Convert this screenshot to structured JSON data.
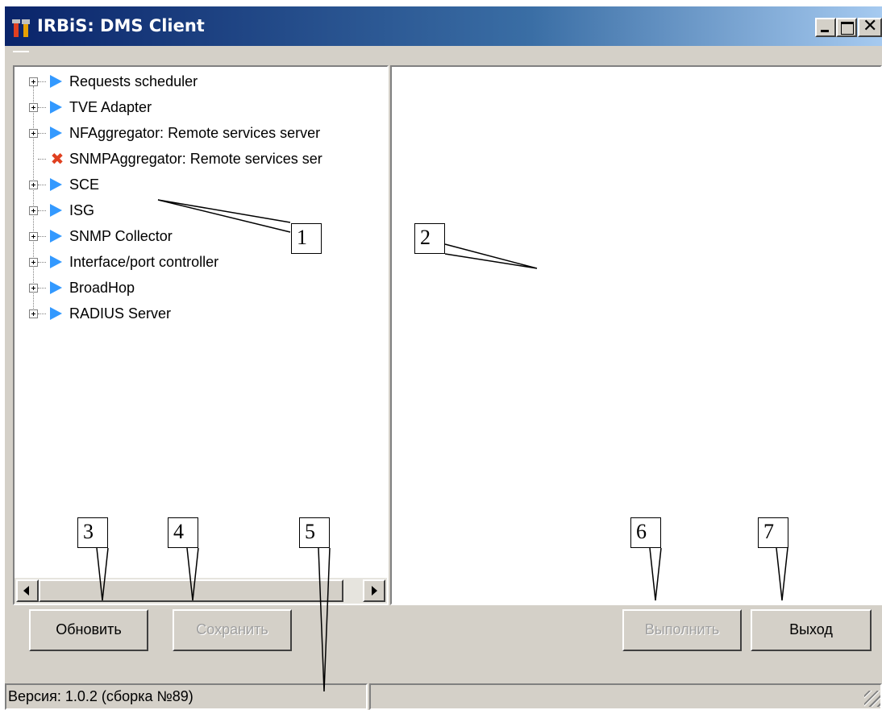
{
  "window": {
    "title": "IRBiS: DMS Client",
    "controls": {
      "minimize": "minimize",
      "maximize": "maximize",
      "close": "close"
    }
  },
  "tree": {
    "items": [
      {
        "label": "Requests scheduler",
        "icon": "play-icon",
        "expandable": true
      },
      {
        "label": "TVE Adapter",
        "icon": "play-icon",
        "expandable": true
      },
      {
        "label": "NFAggregator: Remote services server",
        "icon": "play-icon",
        "expandable": true
      },
      {
        "label": "SNMPAggregator: Remote services ser",
        "icon": "error-x-icon",
        "expandable": false
      },
      {
        "label": "SCE",
        "icon": "play-icon",
        "expandable": true
      },
      {
        "label": "ISG",
        "icon": "play-icon",
        "expandable": true
      },
      {
        "label": "SNMP Collector",
        "icon": "play-icon",
        "expandable": true
      },
      {
        "label": "Interface/port controller",
        "icon": "play-icon",
        "expandable": true
      },
      {
        "label": "BroadHop",
        "icon": "play-icon",
        "expandable": true
      },
      {
        "label": "RADIUS Server",
        "icon": "play-icon",
        "expandable": true
      }
    ]
  },
  "buttons": {
    "refresh": "Обновить",
    "save": "Сохранить",
    "execute": "Выполнить",
    "exit": "Выход"
  },
  "status": {
    "version": "Версия: 1.0.2 (сборка №89)",
    "second": ""
  },
  "callouts": [
    "1",
    "2",
    "3",
    "4",
    "5",
    "6",
    "7"
  ],
  "colors": {
    "title_start": "#0a246a",
    "title_end": "#a6caf0",
    "play_icon": "#3399ff",
    "error_icon": "#e04020",
    "face": "#d4d0c8"
  }
}
